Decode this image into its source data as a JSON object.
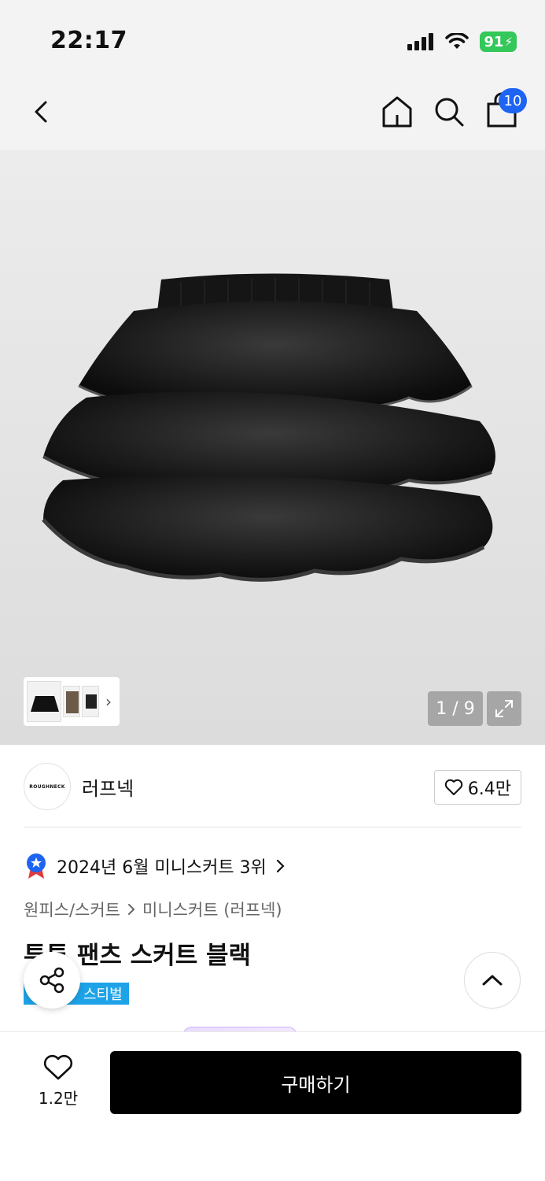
{
  "status_bar": {
    "time": "22:17",
    "battery": "91"
  },
  "nav": {
    "cart_count": "10"
  },
  "gallery": {
    "counter": "1 / 9",
    "chevron": "›"
  },
  "brand": {
    "logo_text": "ROUGHNECK",
    "name": "러프넥",
    "likes": "6.4만"
  },
  "ranking": {
    "text": "2024년 6월 미니스커트 3위"
  },
  "breadcrumb": {
    "category": "원피스/스커트",
    "subcategory": "미니스커트 (러프넥)"
  },
  "product": {
    "title": "투투 팬츠 스커트 블랙",
    "tag": "스티벌"
  },
  "bottom": {
    "wish_count": "1.2만",
    "buy_label": "구매하기"
  },
  "colors": {
    "accent_blue": "#1d64f2",
    "tag_blue": "#1fa3e8",
    "battery_green": "#34c759"
  },
  "icons": [
    "chevron-left-icon",
    "home-icon",
    "search-icon",
    "shopping-bag-icon",
    "expand-icon",
    "heart-icon",
    "ribbon-badge-icon",
    "chevron-right-icon",
    "share-icon",
    "chevron-up-icon"
  ]
}
